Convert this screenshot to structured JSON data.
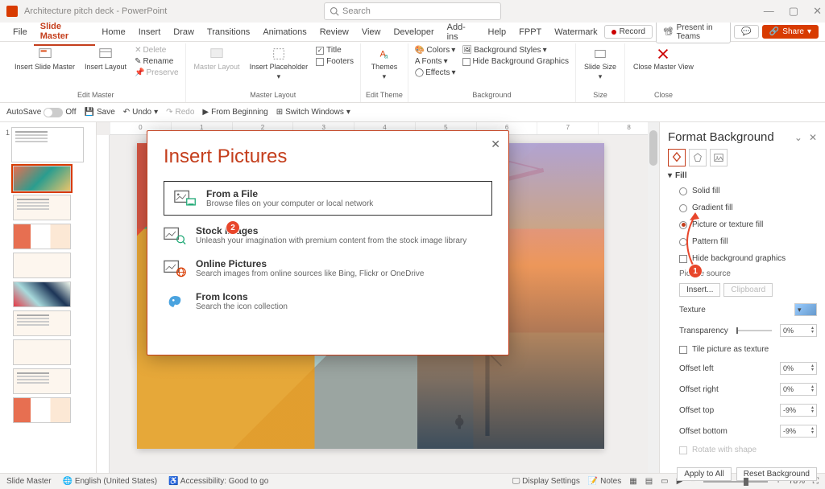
{
  "titlebar": {
    "doc_title": "Architecture pitch deck - PowerPoint",
    "search_placeholder": "Search"
  },
  "window_controls": {
    "min": "—",
    "max": "▢",
    "close": "✕"
  },
  "menu": {
    "tabs": [
      "File",
      "Slide Master",
      "Home",
      "Insert",
      "Draw",
      "Transitions",
      "Animations",
      "Review",
      "View",
      "Developer",
      "Add-ins",
      "Help",
      "FPPT",
      "Watermark"
    ],
    "active": "Slide Master",
    "record": "Record",
    "present": "Present in Teams",
    "share": "Share"
  },
  "ribbon": {
    "edit_master": {
      "label": "Edit Master",
      "insert_slide_master": "Insert Slide Master",
      "insert_layout": "Insert Layout",
      "delete": "Delete",
      "rename": "Rename",
      "preserve": "Preserve"
    },
    "master_layout": {
      "label": "Master Layout",
      "master_layout_btn": "Master Layout",
      "insert_placeholder": "Insert Placeholder",
      "title_chk": "Title",
      "footers_chk": "Footers"
    },
    "edit_theme": {
      "label": "Edit Theme",
      "themes": "Themes"
    },
    "background": {
      "label": "Background",
      "colors": "Colors",
      "fonts": "Fonts",
      "effects": "Effects",
      "bg_styles": "Background Styles",
      "hide_bg": "Hide Background Graphics"
    },
    "size": {
      "label": "Size",
      "slide_size": "Slide Size"
    },
    "close": {
      "label": "Close",
      "close_master": "Close Master View"
    }
  },
  "qat": {
    "autosave": "AutoSave",
    "off": "Off",
    "save": "Save",
    "undo": "Undo",
    "redo": "Redo",
    "from_beginning": "From Beginning",
    "switch_windows": "Switch Windows"
  },
  "ruler_marks": [
    "0",
    "1",
    "2",
    "3",
    "4",
    "5",
    "6",
    "7",
    "8"
  ],
  "dialog": {
    "title": "Insert Pictures",
    "options": [
      {
        "title": "From a File",
        "desc": "Browse files on your computer or local network"
      },
      {
        "title": "Stock Images",
        "desc": "Unleash your imagination with premium content from the stock image library"
      },
      {
        "title": "Online Pictures",
        "desc": "Search images from online sources like Bing, Flickr or OneDrive"
      },
      {
        "title": "From Icons",
        "desc": "Search the icon collection"
      }
    ]
  },
  "callouts": {
    "c1": "1",
    "c2": "2"
  },
  "rpane": {
    "title": "Format Background",
    "section_fill": "Fill",
    "solid": "Solid fill",
    "gradient": "Gradient fill",
    "picture": "Picture or texture fill",
    "pattern": "Pattern fill",
    "hide_bg": "Hide background graphics",
    "pic_source": "Picture source",
    "insert_btn": "Insert...",
    "clipboard_btn": "Clipboard",
    "texture": "Texture",
    "transparency": "Transparency",
    "transparency_val": "0%",
    "tile": "Tile picture as texture",
    "offset_left": "Offset left",
    "offset_left_val": "0%",
    "offset_right": "Offset right",
    "offset_right_val": "0%",
    "offset_top": "Offset top",
    "offset_top_val": "-9%",
    "offset_bottom": "Offset bottom",
    "offset_bottom_val": "-9%",
    "rotate": "Rotate with shape",
    "apply_all": "Apply to All",
    "reset": "Reset Background"
  },
  "status": {
    "mode": "Slide Master",
    "lang": "English (United States)",
    "access": "Accessibility: Good to go",
    "display": "Display Settings",
    "notes": "Notes",
    "zoom": "78%"
  }
}
